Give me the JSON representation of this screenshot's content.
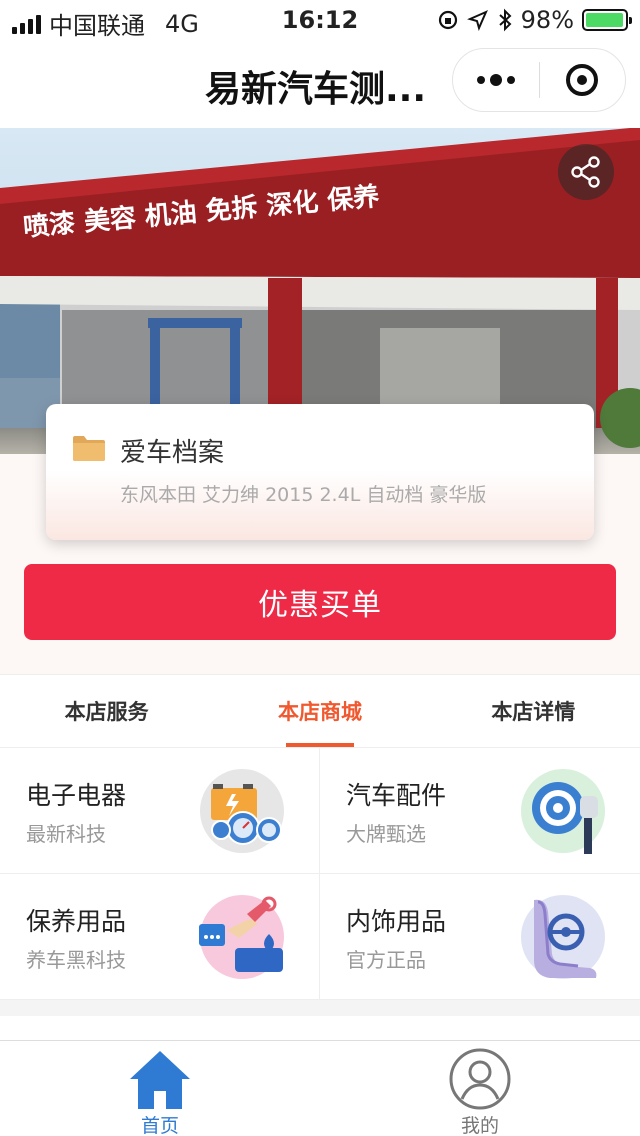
{
  "status_bar": {
    "carrier": "中国联通",
    "network": "4G",
    "time": "16:12",
    "battery": "98%",
    "battery_level": 0.98
  },
  "nav": {
    "title": "易新汽车测..."
  },
  "hero": {
    "sign_text": "喷漆 美容 机油 免拆 深化 保养"
  },
  "car_card": {
    "title": "爱车档案",
    "subtitle": "东风本田 艾力绅 2015 2.4L 自动档 豪华版"
  },
  "pay_button": {
    "label": "优惠买单"
  },
  "tabs": [
    {
      "label": "本店服务",
      "active": false
    },
    {
      "label": "本店商城",
      "active": true
    },
    {
      "label": "本店详情",
      "active": false
    }
  ],
  "categories": [
    {
      "title": "电子电器",
      "subtitle": "最新科技",
      "icon": "electronics-icon"
    },
    {
      "title": "汽车配件",
      "subtitle": "大牌甄选",
      "icon": "car-parts-icon"
    },
    {
      "title": "保养用品",
      "subtitle": "养车黑科技",
      "icon": "maintenance-icon"
    },
    {
      "title": "内饰用品",
      "subtitle": "官方正品",
      "icon": "interior-icon"
    }
  ],
  "tab_bar": [
    {
      "label": "首页",
      "icon": "home-icon",
      "active": true
    },
    {
      "label": "我的",
      "icon": "user-icon",
      "active": false
    }
  ],
  "colors": {
    "accent_red": "#ee2a46",
    "tab_active": "#f0592f",
    "tabbar_active": "#2f7bd3",
    "battery_green": "#4cd964"
  }
}
